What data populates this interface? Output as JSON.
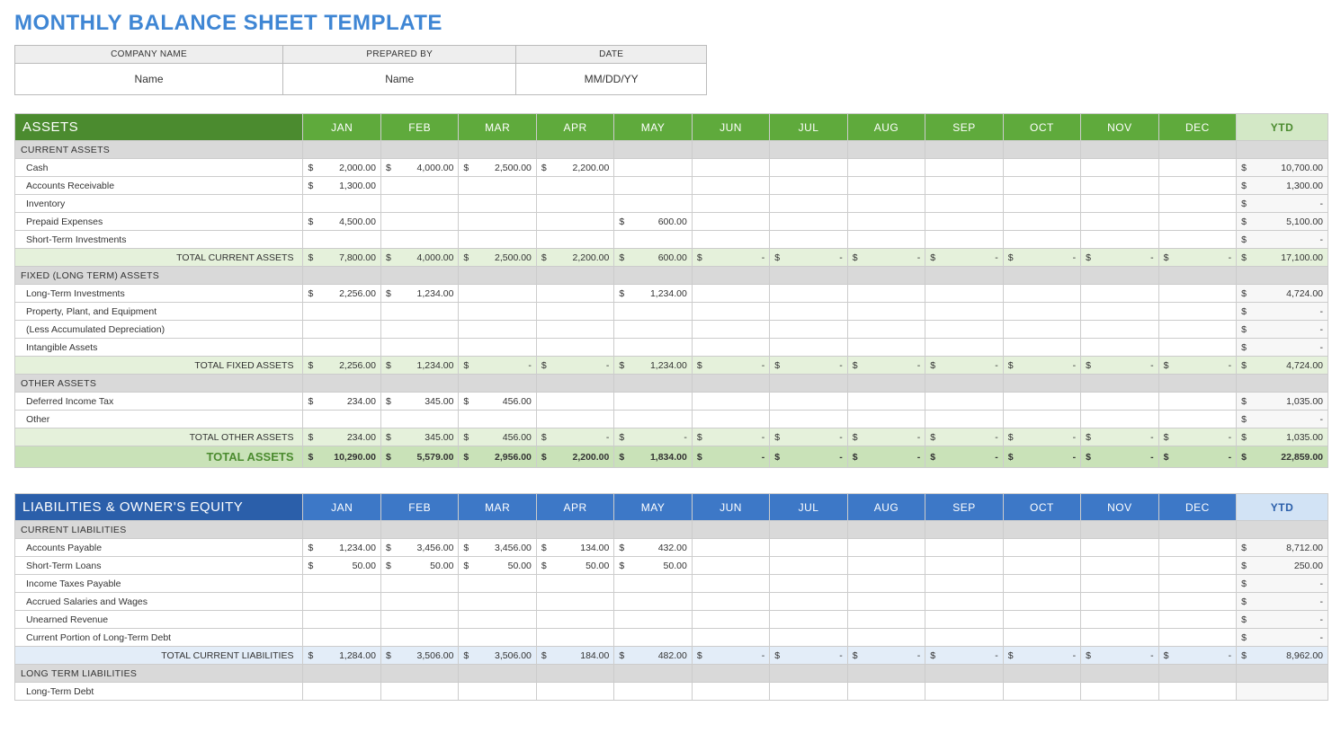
{
  "title": "MONTHLY BALANCE SHEET TEMPLATE",
  "info_headers": [
    "COMPANY NAME",
    "PREPARED BY",
    "DATE"
  ],
  "info_values": [
    "Name",
    "Name",
    "MM/DD/YY"
  ],
  "months": [
    "JAN",
    "FEB",
    "MAR",
    "APR",
    "MAY",
    "JUN",
    "JUL",
    "AUG",
    "SEP",
    "OCT",
    "NOV",
    "DEC"
  ],
  "ytd_label": "YTD",
  "assets": {
    "heading": "ASSETS",
    "groups": [
      {
        "name": "CURRENT ASSETS",
        "rows": [
          {
            "label": "Cash",
            "vals": [
              "2,000.00",
              "4,000.00",
              "2,500.00",
              "2,200.00",
              "",
              "",
              "",
              "",
              "",
              "",
              "",
              ""
            ],
            "ytd": "10,700.00"
          },
          {
            "label": "Accounts Receivable",
            "vals": [
              "1,300.00",
              "",
              "",
              "",
              "",
              "",
              "",
              "",
              "",
              "",
              "",
              ""
            ],
            "ytd": "1,300.00"
          },
          {
            "label": "Inventory",
            "vals": [
              "",
              "",
              "",
              "",
              "",
              "",
              "",
              "",
              "",
              "",
              "",
              ""
            ],
            "ytd": "-"
          },
          {
            "label": "Prepaid Expenses",
            "vals": [
              "4,500.00",
              "",
              "",
              "",
              "600.00",
              "",
              "",
              "",
              "",
              "",
              "",
              ""
            ],
            "ytd": "5,100.00"
          },
          {
            "label": "Short-Term Investments",
            "vals": [
              "",
              "",
              "",
              "",
              "",
              "",
              "",
              "",
              "",
              "",
              "",
              ""
            ],
            "ytd": "-"
          }
        ],
        "subtotal": {
          "label": "TOTAL CURRENT ASSETS",
          "vals": [
            "7,800.00",
            "4,000.00",
            "2,500.00",
            "2,200.00",
            "600.00",
            "-",
            "-",
            "-",
            "-",
            "-",
            "-",
            "-"
          ],
          "ytd": "17,100.00"
        }
      },
      {
        "name": "FIXED (LONG TERM) ASSETS",
        "rows": [
          {
            "label": "Long-Term Investments",
            "vals": [
              "2,256.00",
              "1,234.00",
              "",
              "",
              "1,234.00",
              "",
              "",
              "",
              "",
              "",
              "",
              ""
            ],
            "ytd": "4,724.00"
          },
          {
            "label": "Property, Plant, and Equipment",
            "vals": [
              "",
              "",
              "",
              "",
              "",
              "",
              "",
              "",
              "",
              "",
              "",
              ""
            ],
            "ytd": "-"
          },
          {
            "label": "(Less Accumulated Depreciation)",
            "vals": [
              "",
              "",
              "",
              "",
              "",
              "",
              "",
              "",
              "",
              "",
              "",
              ""
            ],
            "ytd": "-"
          },
          {
            "label": "Intangible Assets",
            "vals": [
              "",
              "",
              "",
              "",
              "",
              "",
              "",
              "",
              "",
              "",
              "",
              ""
            ],
            "ytd": "-"
          }
        ],
        "subtotal": {
          "label": "TOTAL FIXED ASSETS",
          "vals": [
            "2,256.00",
            "1,234.00",
            "-",
            "-",
            "1,234.00",
            "-",
            "-",
            "-",
            "-",
            "-",
            "-",
            "-"
          ],
          "ytd": "4,724.00"
        }
      },
      {
        "name": "OTHER ASSETS",
        "rows": [
          {
            "label": "Deferred Income Tax",
            "vals": [
              "234.00",
              "345.00",
              "456.00",
              "",
              "",
              "",
              "",
              "",
              "",
              "",
              "",
              ""
            ],
            "ytd": "1,035.00"
          },
          {
            "label": "Other",
            "vals": [
              "",
              "",
              "",
              "",
              "",
              "",
              "",
              "",
              "",
              "",
              "",
              ""
            ],
            "ytd": "-"
          }
        ],
        "subtotal": {
          "label": "TOTAL OTHER ASSETS",
          "vals": [
            "234.00",
            "345.00",
            "456.00",
            "-",
            "-",
            "-",
            "-",
            "-",
            "-",
            "-",
            "-",
            "-"
          ],
          "ytd": "1,035.00"
        }
      }
    ],
    "grand": {
      "label": "TOTAL ASSETS",
      "vals": [
        "10,290.00",
        "5,579.00",
        "2,956.00",
        "2,200.00",
        "1,834.00",
        "-",
        "-",
        "-",
        "-",
        "-",
        "-",
        "-"
      ],
      "ytd": "22,859.00"
    }
  },
  "liabilities": {
    "heading": "LIABILITIES & OWNER'S EQUITY",
    "groups": [
      {
        "name": "CURRENT LIABILITIES",
        "rows": [
          {
            "label": "Accounts Payable",
            "vals": [
              "1,234.00",
              "3,456.00",
              "3,456.00",
              "134.00",
              "432.00",
              "",
              "",
              "",
              "",
              "",
              "",
              ""
            ],
            "ytd": "8,712.00"
          },
          {
            "label": "Short-Term Loans",
            "vals": [
              "50.00",
              "50.00",
              "50.00",
              "50.00",
              "50.00",
              "",
              "",
              "",
              "",
              "",
              "",
              ""
            ],
            "ytd": "250.00"
          },
          {
            "label": "Income Taxes Payable",
            "vals": [
              "",
              "",
              "",
              "",
              "",
              "",
              "",
              "",
              "",
              "",
              "",
              ""
            ],
            "ytd": "-"
          },
          {
            "label": "Accrued Salaries and Wages",
            "vals": [
              "",
              "",
              "",
              "",
              "",
              "",
              "",
              "",
              "",
              "",
              "",
              ""
            ],
            "ytd": "-"
          },
          {
            "label": "Unearned Revenue",
            "vals": [
              "",
              "",
              "",
              "",
              "",
              "",
              "",
              "",
              "",
              "",
              "",
              ""
            ],
            "ytd": "-"
          },
          {
            "label": "Current Portion of Long-Term Debt",
            "vals": [
              "",
              "",
              "",
              "",
              "",
              "",
              "",
              "",
              "",
              "",
              "",
              ""
            ],
            "ytd": "-"
          }
        ],
        "subtotal": {
          "label": "TOTAL CURRENT LIABILITIES",
          "vals": [
            "1,284.00",
            "3,506.00",
            "3,506.00",
            "184.00",
            "482.00",
            "-",
            "-",
            "-",
            "-",
            "-",
            "-",
            "-"
          ],
          "ytd": "8,962.00"
        }
      },
      {
        "name": "LONG TERM LIABILITIES",
        "rows": [
          {
            "label": "Long-Term Debt",
            "vals": [
              "",
              "",
              "",
              "",
              "",
              "",
              "",
              "",
              "",
              "",
              "",
              ""
            ],
            "ytd": ""
          }
        ]
      }
    ]
  }
}
